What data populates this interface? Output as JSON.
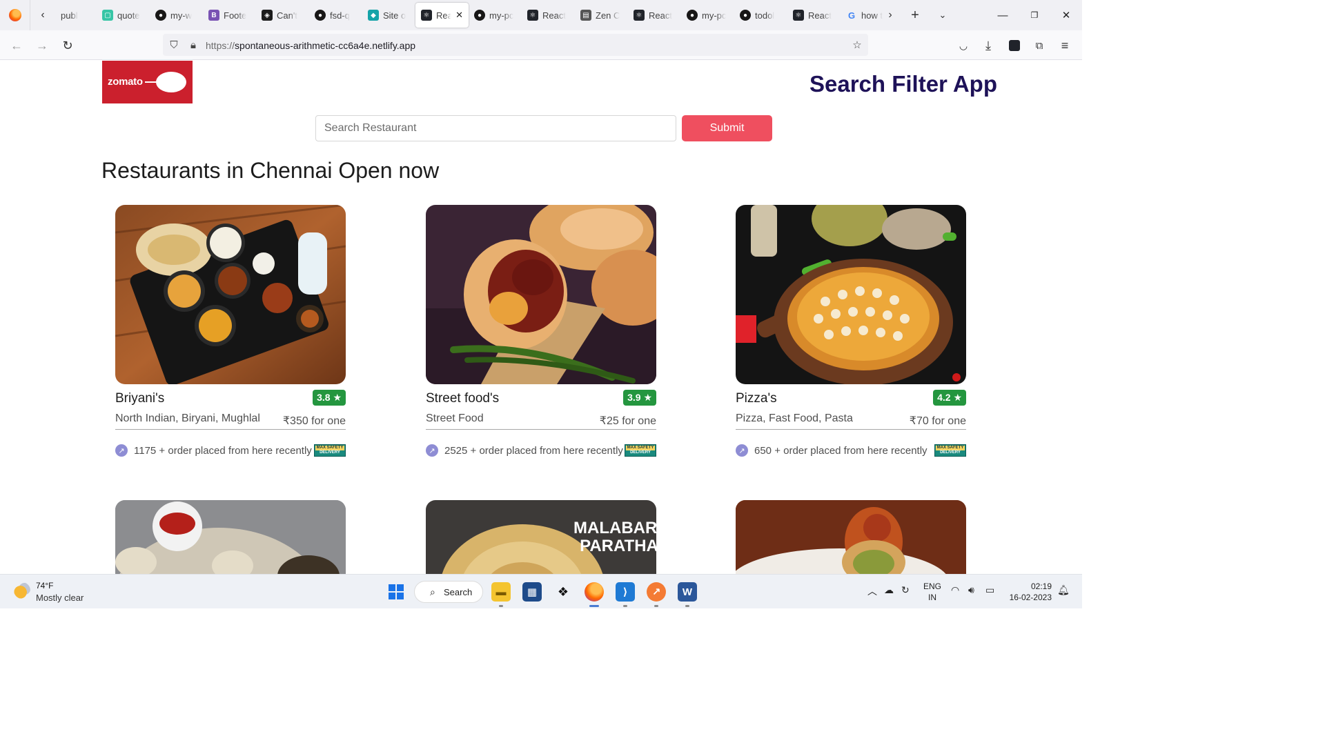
{
  "browser": {
    "tabs": [
      {
        "label": "publ",
        "icon": "generic-page-icon",
        "color": "#ffffff"
      },
      {
        "label": "quote",
        "icon": "page-icon",
        "color": "#38c5a6"
      },
      {
        "label": "my-w",
        "icon": "github-icon",
        "color": "#181717"
      },
      {
        "label": "Foote",
        "icon": "bootstrap-icon",
        "color": "#7952b3"
      },
      {
        "label": "Can't",
        "icon": "diamond-icon",
        "color": "#1c1c1c"
      },
      {
        "label": "fsd-q",
        "icon": "github-icon",
        "color": "#181717"
      },
      {
        "label": "Site o",
        "icon": "netlify-icon",
        "color": "#15a3a8"
      },
      {
        "label": "Rea",
        "icon": "react-icon",
        "color": "#20232a",
        "active": true
      },
      {
        "label": "my-pc",
        "icon": "github-icon",
        "color": "#181717"
      },
      {
        "label": "React",
        "icon": "react-icon",
        "color": "#20232a"
      },
      {
        "label": "Zen C",
        "icon": "zen-class-icon",
        "color": "#555555"
      },
      {
        "label": "React",
        "icon": "react-icon",
        "color": "#20232a"
      },
      {
        "label": "my-pc",
        "icon": "github-icon",
        "color": "#181717"
      },
      {
        "label": "todol",
        "icon": "github-icon",
        "color": "#181717"
      },
      {
        "label": "React",
        "icon": "react-icon",
        "color": "#20232a"
      },
      {
        "label": "how t",
        "icon": "google-icon",
        "color": "#4285f4"
      }
    ],
    "url_scheme": "https://",
    "url_host": "spontaneous-arithmetic-cc6a4e.netlify.app"
  },
  "page": {
    "logo_text": "zomato",
    "app_title": "Search Filter App",
    "search_placeholder": "Search Restaurant",
    "submit_label": "Submit",
    "section_title": "Restaurants in Chennai Open now",
    "accent": "#ef4f5f",
    "rating_color": "#24963f",
    "restaurants": [
      {
        "name": "Briyani's",
        "rating": "3.8 ★",
        "cuisine": "North Indian, Biryani, Mughlal",
        "price": "₹350 for one",
        "orders": "1175 + order placed from here recently",
        "image": "biryani-thali-photo"
      },
      {
        "name": "Street food's",
        "rating": "3.9 ★",
        "cuisine": "Street Food",
        "price": "₹25 for one",
        "orders": "2525 + order placed from here recently",
        "image": "vada-pav-photo"
      },
      {
        "name": "Pizza's",
        "rating": "4.2 ★",
        "cuisine": "Pizza, Fast Food, Pasta",
        "price": "₹70 for one",
        "orders": "650 + order placed from here recently",
        "image": "pizza-photo"
      },
      {
        "image": "momos-photo"
      },
      {
        "image": "malabar-paratha-photo",
        "overlay_text": [
          "MALABAR",
          "PARATHA"
        ]
      },
      {
        "image": "chicken-roll-photo"
      }
    ],
    "safety_badge": [
      "MAX SAFETY",
      "DELIVERY"
    ]
  },
  "taskbar": {
    "temperature": "74°F",
    "condition": "Mostly clear",
    "search_label": "Search",
    "language": [
      "ENG",
      "IN"
    ],
    "time": "02:19",
    "date": "16-02-2023"
  }
}
